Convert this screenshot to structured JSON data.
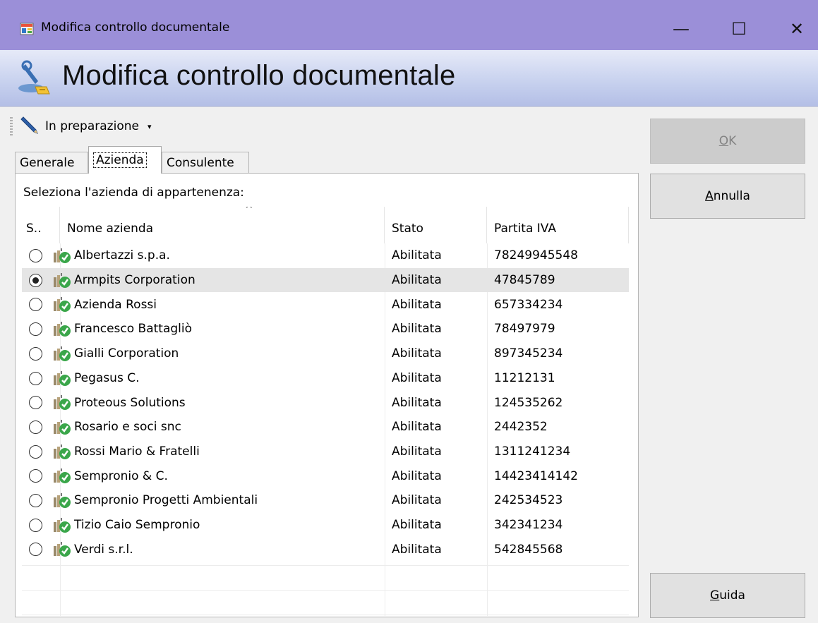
{
  "window": {
    "title": "Modifica controllo documentale",
    "minimize_glyph": "—",
    "maximize_glyph": "☐",
    "close_glyph": "✕"
  },
  "banner": {
    "title": "Modifica controllo documentale"
  },
  "toolbar": {
    "status_label": "In preparazione",
    "status_caret": "▾",
    "status_icon": "pencil-icon"
  },
  "tabs": [
    {
      "label": "Generale",
      "active": false
    },
    {
      "label": "Azienda",
      "active": true
    },
    {
      "label": "Consulente",
      "active": false
    }
  ],
  "panel": {
    "label": "Seleziona l'azienda di appartenenza:",
    "sort_indicator": "^",
    "columns": [
      "S..",
      "Nome azienda",
      "Stato",
      "Partita IVA"
    ],
    "rows": [
      {
        "selected": false,
        "name": "Albertazzi s.p.a.",
        "stato": "Abilitata",
        "piva": "78249945548"
      },
      {
        "selected": true,
        "name": "Armpits Corporation",
        "stato": "Abilitata",
        "piva": "47845789"
      },
      {
        "selected": false,
        "name": "Azienda Rossi",
        "stato": "Abilitata",
        "piva": "657334234"
      },
      {
        "selected": false,
        "name": "Francesco Battagliò",
        "stato": "Abilitata",
        "piva": "78497979"
      },
      {
        "selected": false,
        "name": "Gialli Corporation",
        "stato": "Abilitata",
        "piva": "897345234"
      },
      {
        "selected": false,
        "name": "Pegasus C.",
        "stato": "Abilitata",
        "piva": "11212131"
      },
      {
        "selected": false,
        "name": "Proteous Solutions",
        "stato": "Abilitata",
        "piva": "124535262"
      },
      {
        "selected": false,
        "name": "Rosario e soci snc",
        "stato": "Abilitata",
        "piva": "2442352"
      },
      {
        "selected": false,
        "name": "Rossi Mario & Fratelli",
        "stato": "Abilitata",
        "piva": "1311241234"
      },
      {
        "selected": false,
        "name": "Sempronio & C.",
        "stato": "Abilitata",
        "piva": "14423414142"
      },
      {
        "selected": false,
        "name": "Sempronio Progetti Ambientali",
        "stato": "Abilitata",
        "piva": "242534523"
      },
      {
        "selected": false,
        "name": "Tizio Caio Sempronio",
        "stato": "Abilitata",
        "piva": "342341234"
      },
      {
        "selected": false,
        "name": "Verdi s.r.l.",
        "stato": "Abilitata",
        "piva": "542845568"
      }
    ],
    "row_icon": "company-enabled-icon"
  },
  "buttons": {
    "ok": {
      "mnemonic": "O",
      "rest": "K",
      "enabled": false
    },
    "annulla": {
      "mnemonic": "A",
      "rest": "nnulla",
      "enabled": true
    },
    "guida": {
      "mnemonic": "G",
      "rest": "uida",
      "enabled": true
    }
  },
  "colors": {
    "titlebar": "#9b8fd8",
    "selected_row": "#e5e5e5",
    "enabled_check": "#3aa64a"
  }
}
